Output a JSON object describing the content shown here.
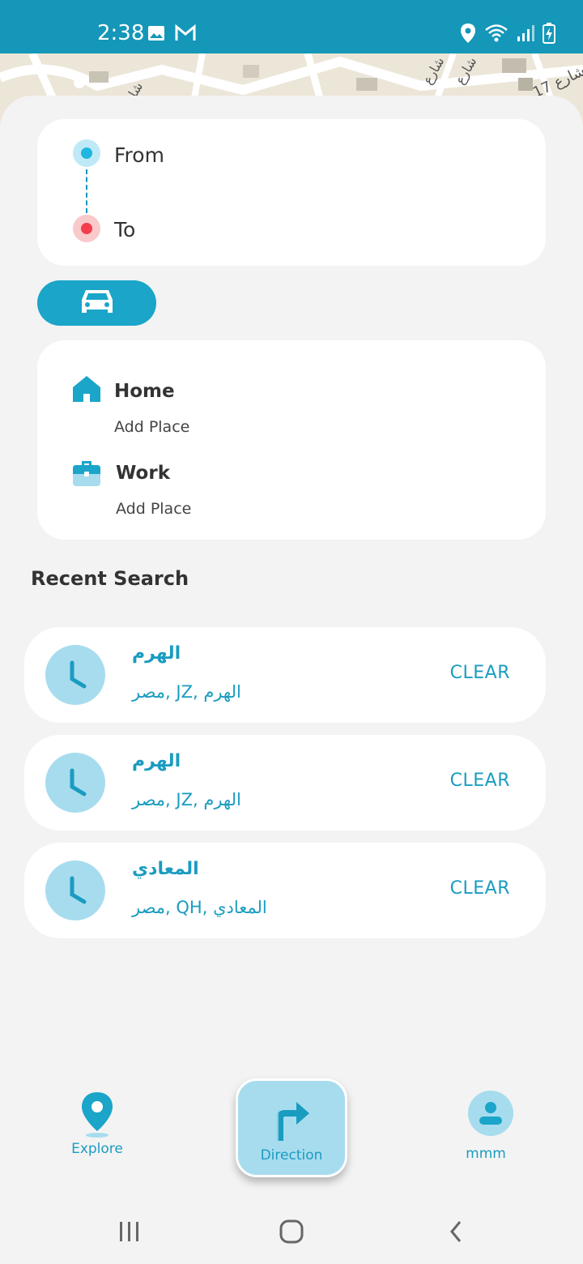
{
  "status_bar": {
    "time": "2:38",
    "icons": [
      "gallery-icon",
      "gmail-icon",
      "location-icon",
      "wifi-icon",
      "signal-icon",
      "battery-charging-icon"
    ]
  },
  "map": {
    "street_labels": [
      "شارع 17",
      "شارع",
      "شارع",
      "شا"
    ]
  },
  "route": {
    "from_label": "From",
    "to_label": "To"
  },
  "transport_mode": {
    "selected": "car-icon"
  },
  "places": [
    {
      "title": "Home",
      "subtitle": "Add Place",
      "icon": "home-icon"
    },
    {
      "title": "Work",
      "subtitle": "Add Place",
      "icon": "briefcase-icon"
    }
  ],
  "recent": {
    "title": "Recent Search",
    "items": [
      {
        "name": "الهرم",
        "address": "مصر, JZ, الهرم",
        "action": "CLEAR"
      },
      {
        "name": "الهرم",
        "address": "مصر, JZ, الهرم",
        "action": "CLEAR"
      },
      {
        "name": "المعادي",
        "address": "مصر, QH, المعادي",
        "action": "CLEAR"
      }
    ]
  },
  "bottom_nav": {
    "items": [
      {
        "label": "Explore",
        "icon": "map-pin-icon"
      },
      {
        "label": "Direction",
        "icon": "turn-right-arrow-icon",
        "active": true
      },
      {
        "label": "mmm",
        "icon": "user-icon"
      }
    ]
  },
  "colors": {
    "primary": "#1497b8",
    "accent": "#1aa5c9",
    "light_accent": "#a7dcee",
    "from_dot": "#1fb6e0",
    "to_dot": "#f33e4b"
  }
}
